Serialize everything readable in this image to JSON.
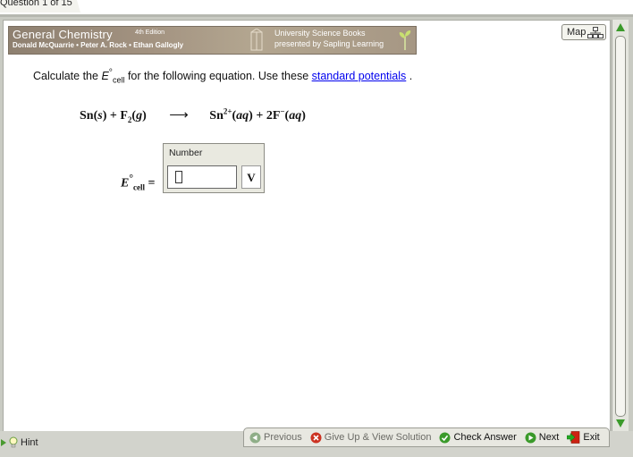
{
  "question_tab": {
    "label": "Question 1 of 15"
  },
  "banner": {
    "title": "General Chemistry",
    "edition": "4th Edition",
    "authors": "Donald McQuarrie • Peter A. Rock • Ethan Gallogly",
    "publisher_line1": "University Science Books",
    "publisher_line2": "presented by Sapling Learning"
  },
  "map_button": {
    "label": "Map"
  },
  "question": {
    "prefix": "Calculate the ",
    "e_symbol": "E",
    "degree": "°",
    "sub": "cell",
    "middle": " for the following equation. Use these ",
    "link": "standard potentials",
    "suffix": " ."
  },
  "equation": {
    "reactant1": "Sn",
    "reactant1_state": "s",
    "plus1": "+",
    "reactant2": "F",
    "reactant2_sub": "2",
    "reactant2_state": "g",
    "arrow": "⟶",
    "product1": "Sn",
    "product1_charge": "2+",
    "product1_state": "aq",
    "plus2": "+",
    "product2_coef": "2",
    "product2": "F",
    "product2_charge": "−",
    "product2_state": "aq"
  },
  "answer": {
    "e_symbol": "E",
    "degree": "°",
    "sub": "cell",
    "equals": "=",
    "box_label": "Number",
    "value": "",
    "unit": "V"
  },
  "hint": {
    "label": "Hint"
  },
  "nav": {
    "previous": "Previous",
    "give_up": "Give Up & View Solution",
    "check": "Check Answer",
    "next": "Next",
    "exit": "Exit"
  },
  "colors": {
    "link": "#0000ee",
    "check_green": "#3a9a2a",
    "give_up_red": "#cc3322",
    "exit_red": "#cc2211"
  }
}
